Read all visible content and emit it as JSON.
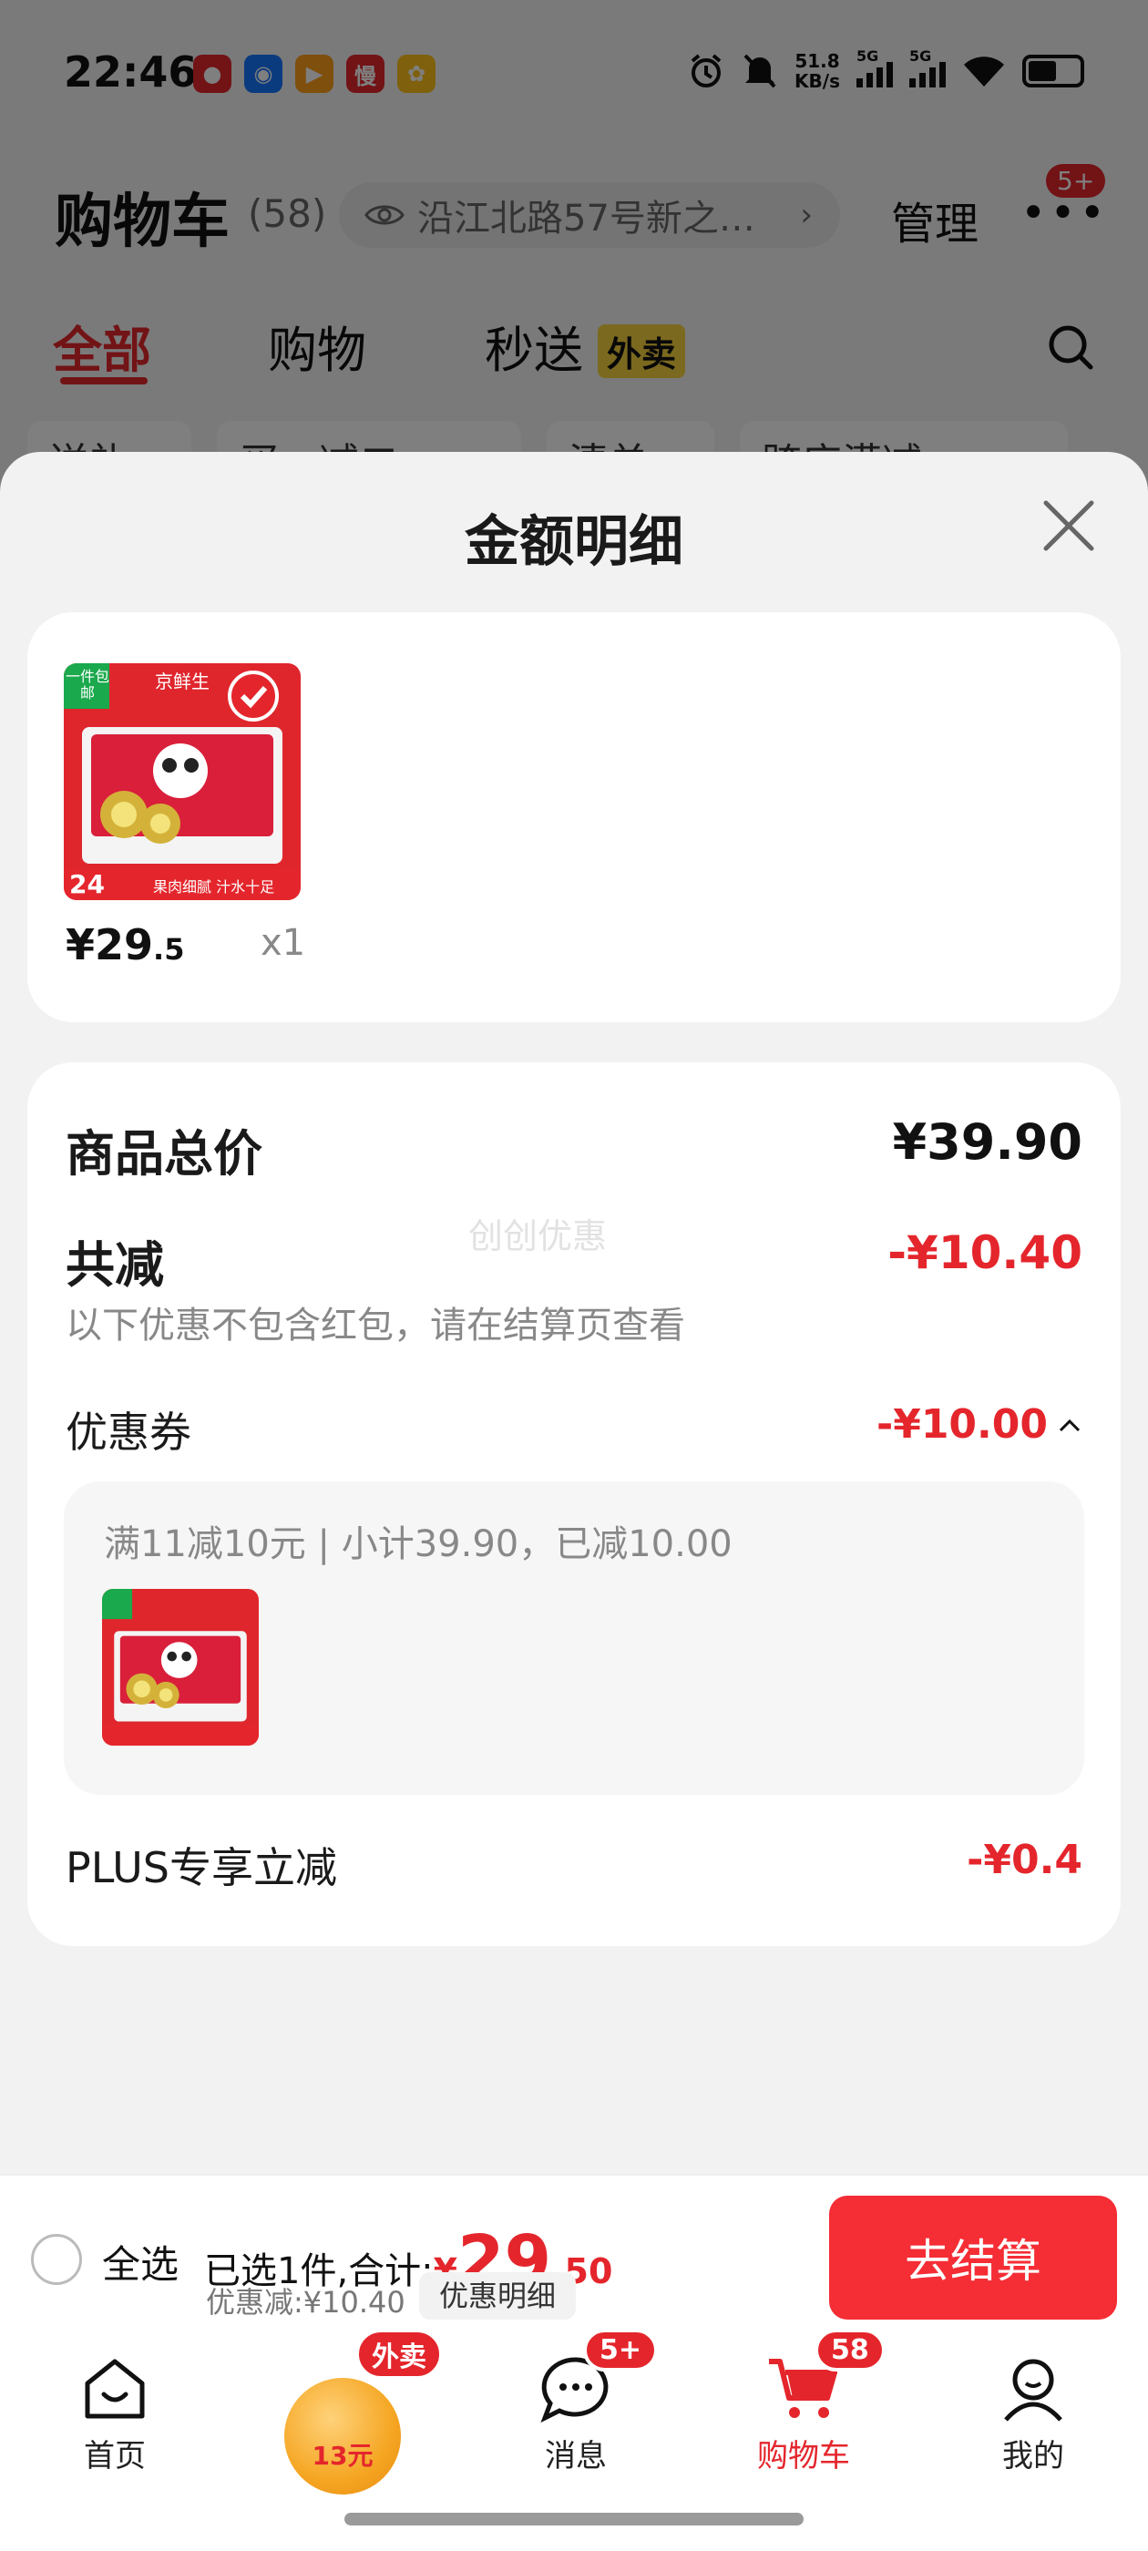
{
  "status_bar": {
    "time": "22:46",
    "net_speed_value": "51.8",
    "net_speed_unit": "KB/s",
    "signal1": "5G",
    "signal2": "5G",
    "app_icons": [
      "app-icon-1",
      "app-icon-2",
      "app-icon-3",
      "app-icon-4",
      "app-icon-5"
    ],
    "app_icon_4_text": "慢"
  },
  "header": {
    "title": "购物车",
    "count": "(58)",
    "address": "沿江北路57号新之…",
    "manage": "管理",
    "more_badge": "5+"
  },
  "tabs": {
    "all": "全部",
    "shopping": "购物",
    "instant": "秒送",
    "instant_tag": "外卖"
  },
  "filters": [
    "送礼",
    "买一减二",
    "清单",
    "跨店满减"
  ],
  "sheet": {
    "title": "金额明细",
    "product": {
      "tag": "一件包邮",
      "brand": "京鲜生",
      "price_int": "¥29",
      "price_dec": ".5",
      "qty": "x1",
      "count_label": "24",
      "slogan": "果肉细腻 汁水十足"
    },
    "summary": {
      "goods_total_label": "商品总价",
      "goods_total_value": "¥39.90",
      "reduction_label": "共减",
      "reduction_value": "-¥10.40",
      "reduction_note": "以下优惠不包含红包，请在结算页查看",
      "watermark": "创创优惠",
      "coupon_label": "优惠券",
      "coupon_value": "-¥10.00",
      "coupon_desc": "满11减10元 | 小计39.90，已减10.00",
      "plus_label": "PLUS专享立减",
      "plus_value": "-¥0.4"
    }
  },
  "checkout": {
    "select_all": "全选",
    "selected_text": "已选1件,合计:",
    "total_currency": "¥",
    "total_int": "29",
    "total_dec": ".50",
    "discount": "优惠减:¥10.40",
    "detail_button": "优惠明细",
    "checkout_button": "去结算"
  },
  "bottom_nav": {
    "home": "首页",
    "promo_badge": "外卖",
    "promo_value": "13元",
    "messages": "消息",
    "messages_badge": "5+",
    "cart": "购物车",
    "cart_badge": "58",
    "mine": "我的"
  },
  "colors": {
    "accent_red": "#e4262c",
    "checkout_red": "#f52d35",
    "waimai_yellow": "#f7d33f"
  }
}
